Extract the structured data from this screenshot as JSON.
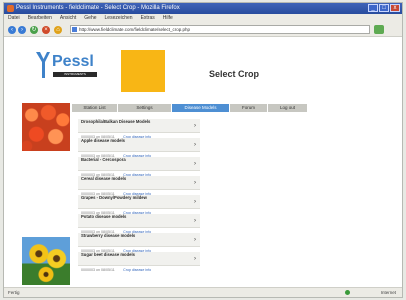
{
  "window": {
    "title": "Pessl Instruments - fieldclimate - Select Crop - Mozilla Firefox",
    "buttons": [
      "_",
      "□",
      "x"
    ]
  },
  "menu": [
    "Datei",
    "Bearbeiten",
    "Ansicht",
    "Gehe",
    "Lesezeichen",
    "Extras",
    "Hilfe"
  ],
  "toolbar": {
    "back_icon": "back-arrow-icon",
    "forward_icon": "forward-arrow-icon",
    "url": "http://www.fieldclimate.com/fieldclimate/select_crop.php",
    "colors": {
      "back": "#3a7bd5",
      "forward": "#3a7bd5",
      "reload": "#4aa04a",
      "stop": "#d04a2a",
      "home": "#e0a21a"
    }
  },
  "brand": {
    "logo_text": "Pessl",
    "logo_sub": "INSTRUMENTS",
    "accent": "#f8b615",
    "tab_active": "#4e8fd3"
  },
  "page": {
    "title": "Select Crop"
  },
  "nav": {
    "tabs": [
      {
        "label": "Station List",
        "active": false
      },
      {
        "label": "Settings",
        "active": false
      },
      {
        "label": "Disease Models",
        "active": true
      },
      {
        "label": "Forum",
        "active": false
      },
      {
        "label": "Log out",
        "active": false
      }
    ]
  },
  "crops": [
    {
      "name": "Drosophila/Balkan Disease Models",
      "meta": "0000003 on 08/05/11",
      "link": "Crop disease info"
    },
    {
      "name": "Apple disease models",
      "meta": "0000003 on 08/05/11",
      "link": "Crop disease info"
    },
    {
      "name": "Bacterial - Cercospora",
      "meta": "0000003 on 08/05/11",
      "link": "Crop disease info"
    },
    {
      "name": "Cereal disease models",
      "meta": "0000003 on 08/05/11",
      "link": "Crop disease info"
    },
    {
      "name": "Grapes - Downy/Powdery mildew",
      "meta": "0000003 on 08/05/11",
      "link": "Crop disease info"
    },
    {
      "name": "Potato disease models",
      "meta": "0000003 on 08/05/11",
      "link": "Crop disease info"
    },
    {
      "name": "Strawberry disease models",
      "meta": "0000003 on 08/05/11",
      "link": "Crop disease info"
    },
    {
      "name": "Sugar beet disease models",
      "meta": "0000003 on 08/05/11",
      "link": "Crop disease info"
    }
  ],
  "status": {
    "left": "Fertig",
    "right": "Internet"
  }
}
